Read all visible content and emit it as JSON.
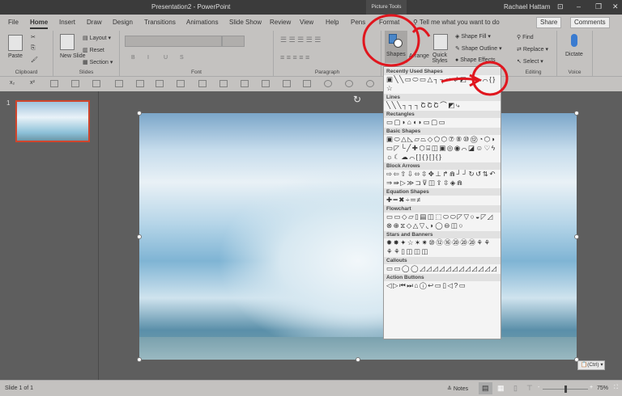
{
  "window": {
    "title": "Presentation2  -  PowerPoint",
    "context_tab": "Picture Tools",
    "user": "Rachael Hattam"
  },
  "tabs": [
    "File",
    "Home",
    "Insert",
    "Draw",
    "Design",
    "Transitions",
    "Animations",
    "Slide Show",
    "Review",
    "View",
    "Help",
    "Pens",
    "Format"
  ],
  "active_tab": "Home",
  "tell_me": "Tell me what you want to do",
  "share": "Share",
  "comments": "Comments",
  "ribbon": {
    "clipboard": {
      "label": "Clipboard",
      "paste": "Paste"
    },
    "slides": {
      "label": "Slides",
      "new_slide": "New Slide",
      "layout": "Layout",
      "reset": "Reset",
      "section": "Section"
    },
    "font": {
      "label": "Font",
      "bold": "B",
      "italic": "I",
      "underline": "U",
      "strike": "S"
    },
    "paragraph": {
      "label": "Paragraph"
    },
    "drawing": {
      "shapes": "Shapes",
      "arrange": "Arrange",
      "quick_styles": "Quick Styles",
      "shape_fill": "Shape Fill",
      "shape_outline": "Shape Outline",
      "shape_effects": "Shape Effects"
    },
    "editing": {
      "label": "Editing",
      "find": "Find",
      "replace": "Replace",
      "select": "Select"
    },
    "voice": {
      "label": "Voice",
      "dictate": "Dictate"
    }
  },
  "gallery": {
    "sections": [
      {
        "title": "Recently Used Shapes",
        "glyphs": "▣╲╲▭⬭▭△┐┐⇨↲◩ ⤷⌒⌒{}☆"
      },
      {
        "title": "Lines",
        "glyphs": "╲╲╲┐┐┐ՇՇՇ⌒◩⤷"
      },
      {
        "title": "Rectangles",
        "glyphs": "▭▢◗⌂◖◗▭▢▭"
      },
      {
        "title": "Basic Shapes",
        "glyphs": "▣⬭△◺▱⏢◇⬠⬡⑦⑧⑩⑫◔⬡◗▭◸└╱✚⬡⌸◫▣◎◉⌒◪☺♡ϟ☼☾☁⌒[]{}[]{}"
      },
      {
        "title": "Block Arrows",
        "glyphs": "⇨⇦⇧⇩⬄⇳✥⊥↱⋒┘┘↻↺⇅↶⇒⇛▷≫⊐⊽◫⇪⇳◈⋒"
      },
      {
        "title": "Equation Shapes",
        "glyphs": "✚━✖÷═≠"
      },
      {
        "title": "Flowchart",
        "glyphs": "▭▭◇▱▯▤◫⬚⬭⬭◸▽○◒◸◿⊗⊕⧖◇△▽◟◗◯⊖◫○"
      },
      {
        "title": "Stars and Banners",
        "glyphs": "✹✸✦☆✶✷⑩⑫⑯⑳⑳⑳⚘⚘⚘⚘▯◫◫◫"
      },
      {
        "title": "Callouts",
        "glyphs": "▭▭◯◯◿◿◿◿◿◿◿◿◿◿◿◿"
      },
      {
        "title": "Action Buttons",
        "glyphs": "◁▷⏮⏭⌂ⓘ↩▭▯◁?▭"
      }
    ]
  },
  "status": {
    "slide": "Slide 1 of 1",
    "notes": "Notes",
    "zoom": "75%",
    "zoom_level": 0.5
  },
  "paste_options": "(Ctrl)",
  "thumb_number": "1",
  "annotation_color": "#e0161e"
}
